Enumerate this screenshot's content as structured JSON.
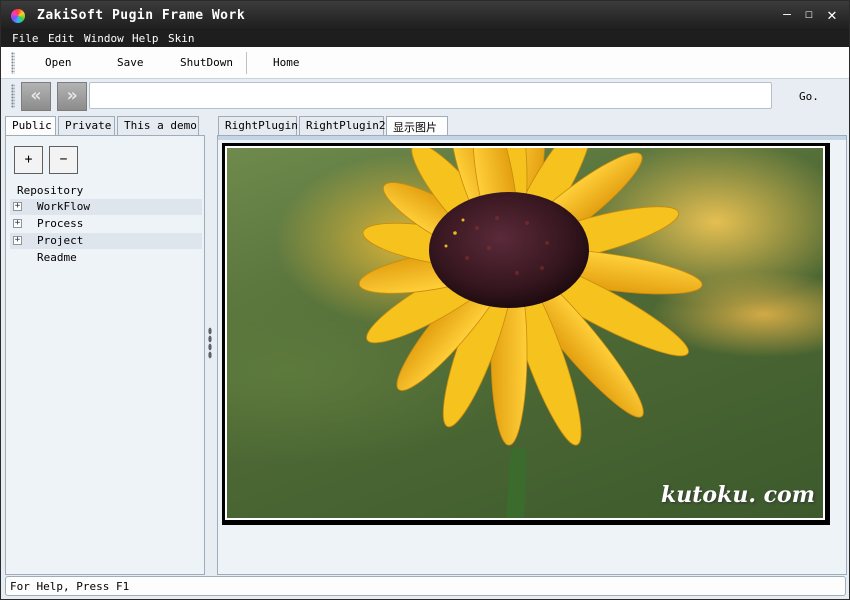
{
  "window": {
    "title": "ZakiSoft Pugin Frame Work",
    "controls": {
      "minimize": "—",
      "maximize": "☐",
      "close": "✕"
    }
  },
  "menu": [
    "File",
    "Edit",
    "Window",
    "Help",
    "Skin"
  ],
  "toolbar": {
    "open": "Open",
    "save": "Save",
    "shutdown": "ShutDown",
    "home": "Home"
  },
  "address": {
    "back_icon": "«",
    "forward_icon": "»",
    "value": "",
    "go_label": "Go."
  },
  "left_tabs": [
    "Public",
    "Private",
    "This a demo"
  ],
  "left_pane": {
    "add_label": "+",
    "remove_label": "−",
    "tree_root": "Repository",
    "tree_items": [
      {
        "label": "WorkFlow",
        "expandable": true,
        "expander": "+"
      },
      {
        "label": "Process",
        "expandable": true,
        "expander": "+"
      },
      {
        "label": "Project",
        "expandable": true,
        "expander": "+"
      },
      {
        "label": "Readme",
        "expandable": false,
        "expander": ""
      }
    ]
  },
  "right_tabs": [
    "RightPlugin",
    "RightPlugin2",
    "显示图片"
  ],
  "image": {
    "watermark": "kutoku. com"
  },
  "status": "For Help, Press F1",
  "colors": {
    "titlebar": "#1c1c1c",
    "pane_bg": "#eef3f8",
    "border": "#9fadbb",
    "petal": "#f4bb1a",
    "flower_center": "#3a1b24"
  }
}
